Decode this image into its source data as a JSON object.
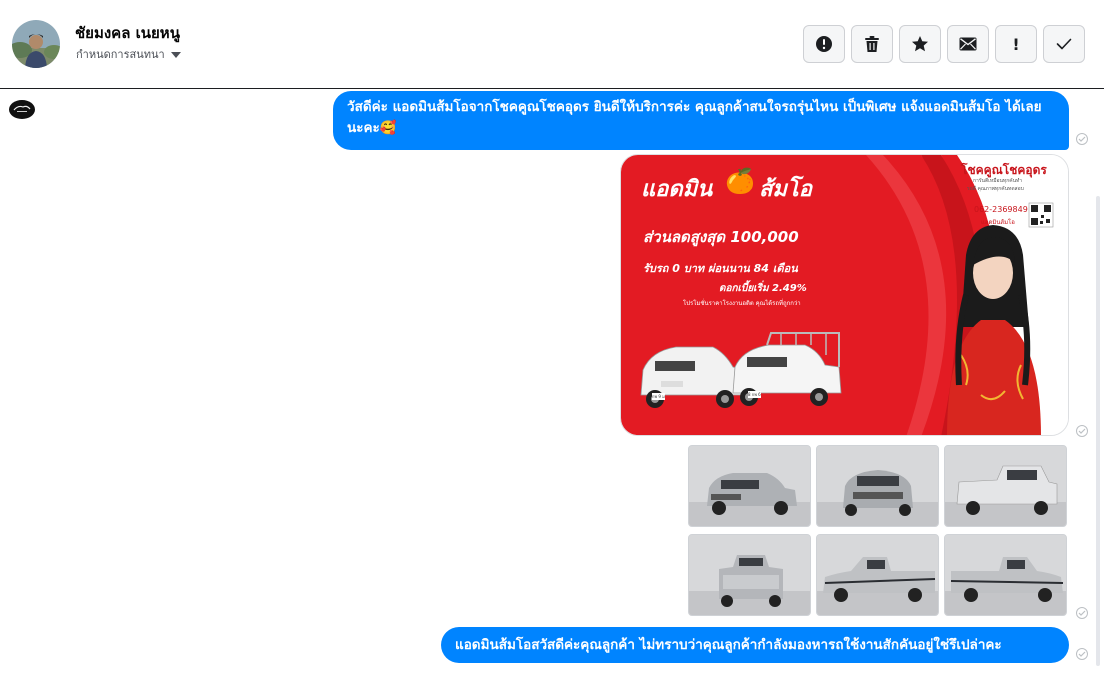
{
  "header": {
    "contact_name": "ชัยมงคล เนยหนู",
    "conversation_settings": "กำหนดการสนทนา",
    "actions": [
      {
        "name": "report",
        "icon": "alert-circle-icon"
      },
      {
        "name": "delete",
        "icon": "trash-icon"
      },
      {
        "name": "star",
        "icon": "star-icon"
      },
      {
        "name": "mark-unread",
        "icon": "envelope-icon"
      },
      {
        "name": "important",
        "glyph": "!"
      },
      {
        "name": "done",
        "icon": "checkmark-icon"
      }
    ]
  },
  "messages": {
    "greeting": "วัสดีค่ะ แอดมินส้มโอจากโชคคูณโชคอุดร ยินดีให้บริการค่ะ  คุณลูกค้าสนใจรถรุ่นไหน เป็นพิเศษ แจ้งแอดมินส้มโอ ได้เลยนะคะ🥰",
    "followup": "แอดมินส้มโอสวัสดีค่ะคุณลูกค้า ไม่ทราบว่าคุณลูกค้ากำลังมองหารถใช้งานสักคันอยู่ใช่รึเปล่าคะ"
  },
  "promo": {
    "brand": "แอดมิน",
    "brand_emoji": "🍊",
    "admin_name": "ส้มโอ",
    "discount": "ส่วนลดสูงสุด 100,000",
    "downpayment": "รับรถ 0 บาท ผ่อนนาน 84 เดือน",
    "interest": "ดอกเบี้ยเริ่ม 2.49%",
    "fineprint": "โปรโมชั่นราคาโรงงานอดิต คุณได้รถที่ถูกกว่า",
    "dealer": "โชคคูณโชคอุดร",
    "dealer_sub1": "การันตีเหมือนทุกคันทำ",
    "dealer_sub2": "รถดี คุณภาพทุกคันทดสอบ",
    "phone": "062-2369849",
    "phone_caption": "แอดมินส้มโอ",
    "plate_1": "กพ 9 ม",
    "plate_2": "8 กพ 6"
  },
  "colors": {
    "accent": "#0084ff",
    "promo_red": "#e31b23",
    "border": "#ced0d4"
  }
}
